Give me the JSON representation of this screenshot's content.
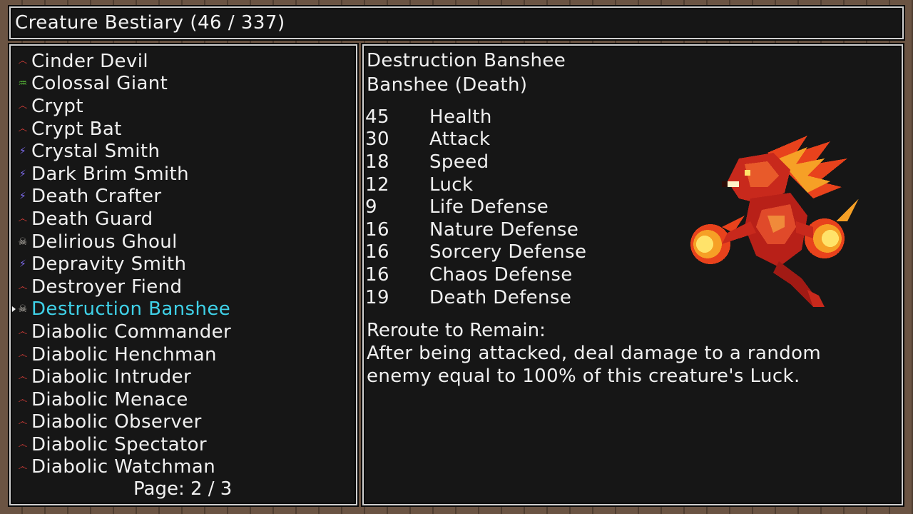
{
  "header": {
    "title": "Creature Bestiary (46 / 337)"
  },
  "list": {
    "items": [
      {
        "label": "Cinder Devil",
        "icon": "devil-swirl-icon",
        "icon_color": "#e8413c",
        "selected": false
      },
      {
        "label": "Colossal Giant",
        "icon": "nature-leaf-icon",
        "icon_color": "#5ec83c",
        "selected": false
      },
      {
        "label": "Crypt",
        "icon": "devil-swirl-icon",
        "icon_color": "#e8413c",
        "selected": false
      },
      {
        "label": "Crypt Bat",
        "icon": "devil-swirl-icon",
        "icon_color": "#e8413c",
        "selected": false
      },
      {
        "label": "Crystal Smith",
        "icon": "sorcery-bolt-icon",
        "icon_color": "#7f6cf0",
        "selected": false
      },
      {
        "label": "Dark Brim Smith",
        "icon": "sorcery-bolt-icon",
        "icon_color": "#7f6cf0",
        "selected": false
      },
      {
        "label": "Death Crafter",
        "icon": "sorcery-bolt-icon",
        "icon_color": "#7f6cf0",
        "selected": false
      },
      {
        "label": "Death Guard",
        "icon": "devil-swirl-icon",
        "icon_color": "#e8413c",
        "selected": false
      },
      {
        "label": "Delirious Ghoul",
        "icon": "death-skull-icon",
        "icon_color": "#c9c4bc",
        "selected": false
      },
      {
        "label": "Depravity Smith",
        "icon": "sorcery-bolt-icon",
        "icon_color": "#7f6cf0",
        "selected": false
      },
      {
        "label": "Destroyer Fiend",
        "icon": "devil-swirl-icon",
        "icon_color": "#e8413c",
        "selected": false
      },
      {
        "label": "Destruction Banshee",
        "icon": "death-skull-icon",
        "icon_color": "#c9c4bc",
        "selected": true
      },
      {
        "label": "Diabolic Commander",
        "icon": "devil-swirl-icon",
        "icon_color": "#e8413c",
        "selected": false
      },
      {
        "label": "Diabolic Henchman",
        "icon": "devil-swirl-icon",
        "icon_color": "#e8413c",
        "selected": false
      },
      {
        "label": "Diabolic Intruder",
        "icon": "devil-swirl-icon",
        "icon_color": "#e8413c",
        "selected": false
      },
      {
        "label": "Diabolic Menace",
        "icon": "devil-swirl-icon",
        "icon_color": "#e8413c",
        "selected": false
      },
      {
        "label": "Diabolic Observer",
        "icon": "devil-swirl-icon",
        "icon_color": "#e8413c",
        "selected": false
      },
      {
        "label": "Diabolic Spectator",
        "icon": "devil-swirl-icon",
        "icon_color": "#e8413c",
        "selected": false
      },
      {
        "label": "Diabolic Watchman",
        "icon": "devil-swirl-icon",
        "icon_color": "#e8413c",
        "selected": false
      }
    ],
    "page_label": "Page: 2 / 3"
  },
  "detail": {
    "name": "Destruction Banshee",
    "type": "Banshee (Death)",
    "sprite_icon": "destruction-banshee-sprite",
    "stats": [
      {
        "value": "45",
        "label": "Health"
      },
      {
        "value": "30",
        "label": "Attack"
      },
      {
        "value": "18",
        "label": "Speed"
      },
      {
        "value": "12",
        "label": "Luck"
      },
      {
        "value": "9",
        "label": "Life Defense"
      },
      {
        "value": "16",
        "label": "Nature Defense"
      },
      {
        "value": "16",
        "label": "Sorcery Defense"
      },
      {
        "value": "16",
        "label": "Chaos Defense"
      },
      {
        "value": "19",
        "label": "Death Defense"
      }
    ],
    "ability_title": "Reroute to Remain:",
    "ability_desc": "After being attacked, deal damage to a random enemy equal to 100% of this creature's Luck."
  },
  "colors": {
    "selected_text": "#3fd1e8",
    "panel_bg": "#161616",
    "panel_border": "#cfcfcf"
  }
}
